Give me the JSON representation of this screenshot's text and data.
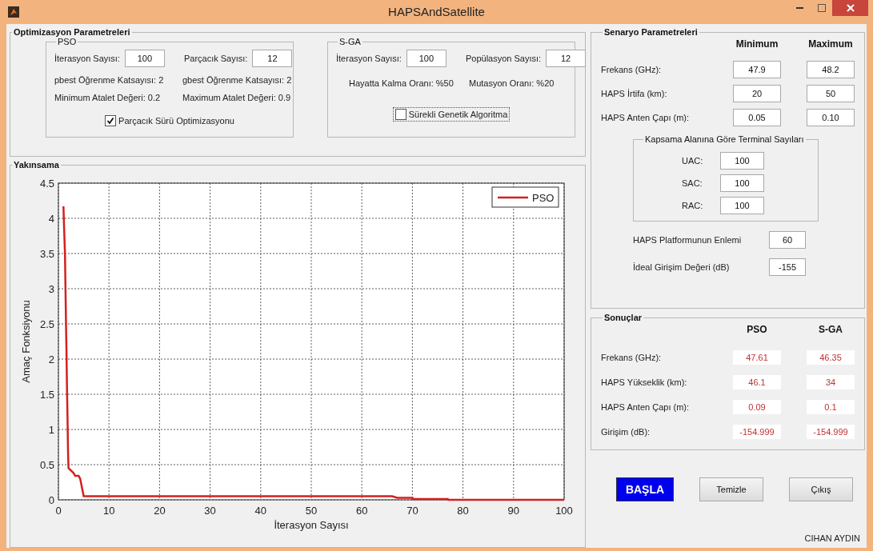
{
  "window": {
    "title": "HAPSAndSatellite"
  },
  "optimization": {
    "title": "Optimizasyon Parametreleri",
    "groups": [
      {
        "title": "PSO",
        "fields": [
          {
            "label": "İterasyon Sayısı:",
            "value": "100"
          },
          {
            "label": "Parçacık Sayısı:",
            "value": "12"
          }
        ],
        "notes": [
          "pbest Öğrenme Katsayısı: 2",
          "gbest Öğrenme Katsayısı: 2",
          "Minimum Atalet Değeri: 0.2",
          "Maximum Atalet Değeri: 0.9"
        ],
        "checkbox": {
          "label": "Parçacık Sürü Optimizasyonu",
          "checked": true
        }
      },
      {
        "title": "S-GA",
        "fields": [
          {
            "label": "İterasyon Sayısı:",
            "value": "100"
          },
          {
            "label": "Popülasyon Sayısı:",
            "value": "12"
          }
        ],
        "notes": [
          "Hayatta Kalma Oranı: %50",
          "Mutasyon Oranı: %20"
        ],
        "checkbox": {
          "label": "Sürekli Genetik Algoritma",
          "checked": false
        }
      }
    ]
  },
  "convergence": {
    "title": "Yakınsama",
    "chart_data": {
      "type": "line",
      "xlabel": "İterasyon Sayısı",
      "ylabel": "Amaç Fonksiyonu",
      "x": [
        1,
        1.1,
        1.3,
        1.5,
        1.6,
        1.7,
        1.8,
        1.9,
        2,
        3,
        3.3,
        4,
        4.3,
        5,
        66,
        67,
        70,
        70.1,
        77,
        77.1,
        100
      ],
      "series": [
        {
          "name": "PSO",
          "color": "#d42020",
          "values": [
            4.17,
            3.9,
            3.5,
            2.5,
            2.1,
            1.6,
            1.15,
            0.7,
            0.45,
            0.38,
            0.34,
            0.34,
            0.3,
            0.05,
            0.05,
            0.03,
            0.03,
            0.01,
            0.01,
            0,
            0
          ]
        }
      ],
      "grid": true,
      "xlim": [
        0,
        100
      ],
      "ylim": [
        0,
        4.5
      ],
      "xticks": [
        0,
        10,
        20,
        30,
        40,
        50,
        60,
        70,
        80,
        90,
        100
      ],
      "yticks": [
        0,
        0.5,
        1,
        1.5,
        2,
        2.5,
        3,
        3.5,
        4,
        4.5
      ]
    }
  },
  "scenario": {
    "title": "Senaryo Parametreleri",
    "columns": [
      "Minimum",
      "Maximum"
    ],
    "rows": [
      {
        "label": "Frekans (GHz):",
        "min": "47.9",
        "max": "48.2"
      },
      {
        "label": "HAPS İrtifa (km):",
        "min": "20",
        "max": "50"
      },
      {
        "label": "HAPS Anten Çapı (m):",
        "min": "0.05",
        "max": "0.10"
      }
    ],
    "terminals": {
      "title": "Kapsama Alanına Göre Terminal Sayıları",
      "rows": [
        {
          "label": "UAC:",
          "value": "100"
        },
        {
          "label": "SAC:",
          "value": "100"
        },
        {
          "label": "RAC:",
          "value": "100"
        }
      ]
    },
    "extras": [
      {
        "label": "HAPS Platformunun Enlemi",
        "value": "60"
      },
      {
        "label": "İdeal Girişim Değeri (dB)",
        "value": "-155"
      }
    ]
  },
  "results": {
    "title": "Sonuçlar",
    "columns": [
      "PSO",
      "S-GA"
    ],
    "rows": [
      {
        "label": "Frekans (GHz):",
        "values": [
          "47.61",
          "46.35"
        ]
      },
      {
        "label": "HAPS Yükseklik (km):",
        "values": [
          "46.1",
          "34"
        ]
      },
      {
        "label": "HAPS Anten Çapı (m):",
        "values": [
          "0.09",
          "0.1"
        ]
      },
      {
        "label": "Girişim (dB):",
        "values": [
          "-154.999",
          "-154.999"
        ]
      }
    ]
  },
  "buttons": [
    {
      "label": "BAŞLA",
      "kind": "primary"
    },
    {
      "label": "Temizle",
      "kind": "normal"
    },
    {
      "label": "Çıkış",
      "kind": "normal"
    }
  ],
  "author": "CIHAN AYDIN"
}
